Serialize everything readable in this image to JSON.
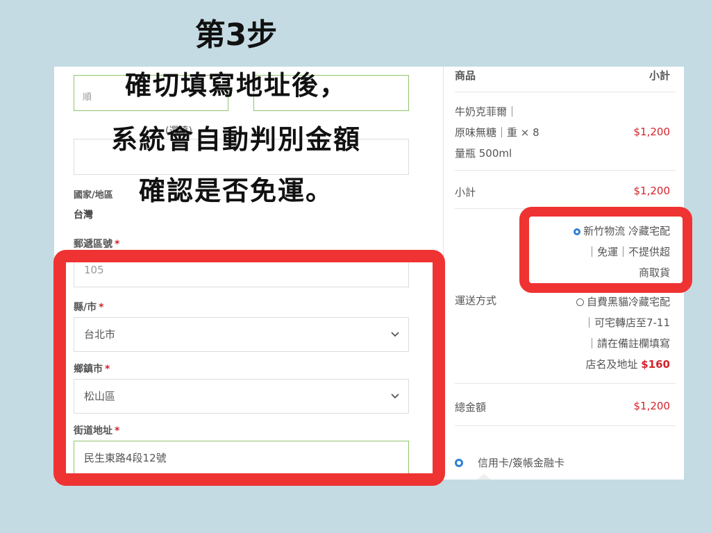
{
  "overlay": {
    "step": "第3步",
    "line1": "確切填寫地址後，",
    "line2": "系統會自動判別金額",
    "line3": "確認是否免運。"
  },
  "form": {
    "first_half_label": "順",
    "second_half_label": "",
    "company_label": "(選填)",
    "country_label": "國家/地區",
    "country_value": "台灣",
    "zip_label": "郵遞區號",
    "zip_value": "105",
    "city_label": "縣/市",
    "city_value": "台北市",
    "district_label": "鄉鎮市",
    "district_value": "松山區",
    "street_label": "街道地址",
    "street_value": "民生東路4段12號",
    "required_mark": "*"
  },
  "summary": {
    "header_product": "商品",
    "header_subtotal": "小計",
    "product_line1": "牛奶克菲爾｜",
    "product_line2": "原味無糖｜重 × 8",
    "product_line3": "量瓶 500ml",
    "product_price": "$1,200",
    "subtotal_label": "小計",
    "subtotal_value": "$1,200",
    "shipping_label": "運送方式",
    "ship_opt1_line1": "新竹物流 冷藏宅配",
    "ship_opt1_line2": "｜免運｜不提供超",
    "ship_opt1_line3": "商取貨",
    "ship_opt2_line1": "自費黑貓冷藏宅配",
    "ship_opt2_line2": "｜可宅轉店至7-11",
    "ship_opt2_line3": "｜請在備註欄填寫",
    "ship_opt2_line4": "店名及地址",
    "ship_opt2_price": "$160",
    "total_label": "總金額",
    "total_value": "$1,200",
    "payment_label": "信用卡/簽帳金融卡"
  },
  "colors": {
    "background": "#c4dbe3",
    "highlight_red": "#ef3332",
    "price_red": "#d3232b",
    "radio_blue": "#2f7fd6",
    "focus_green": "#8dc46e"
  }
}
